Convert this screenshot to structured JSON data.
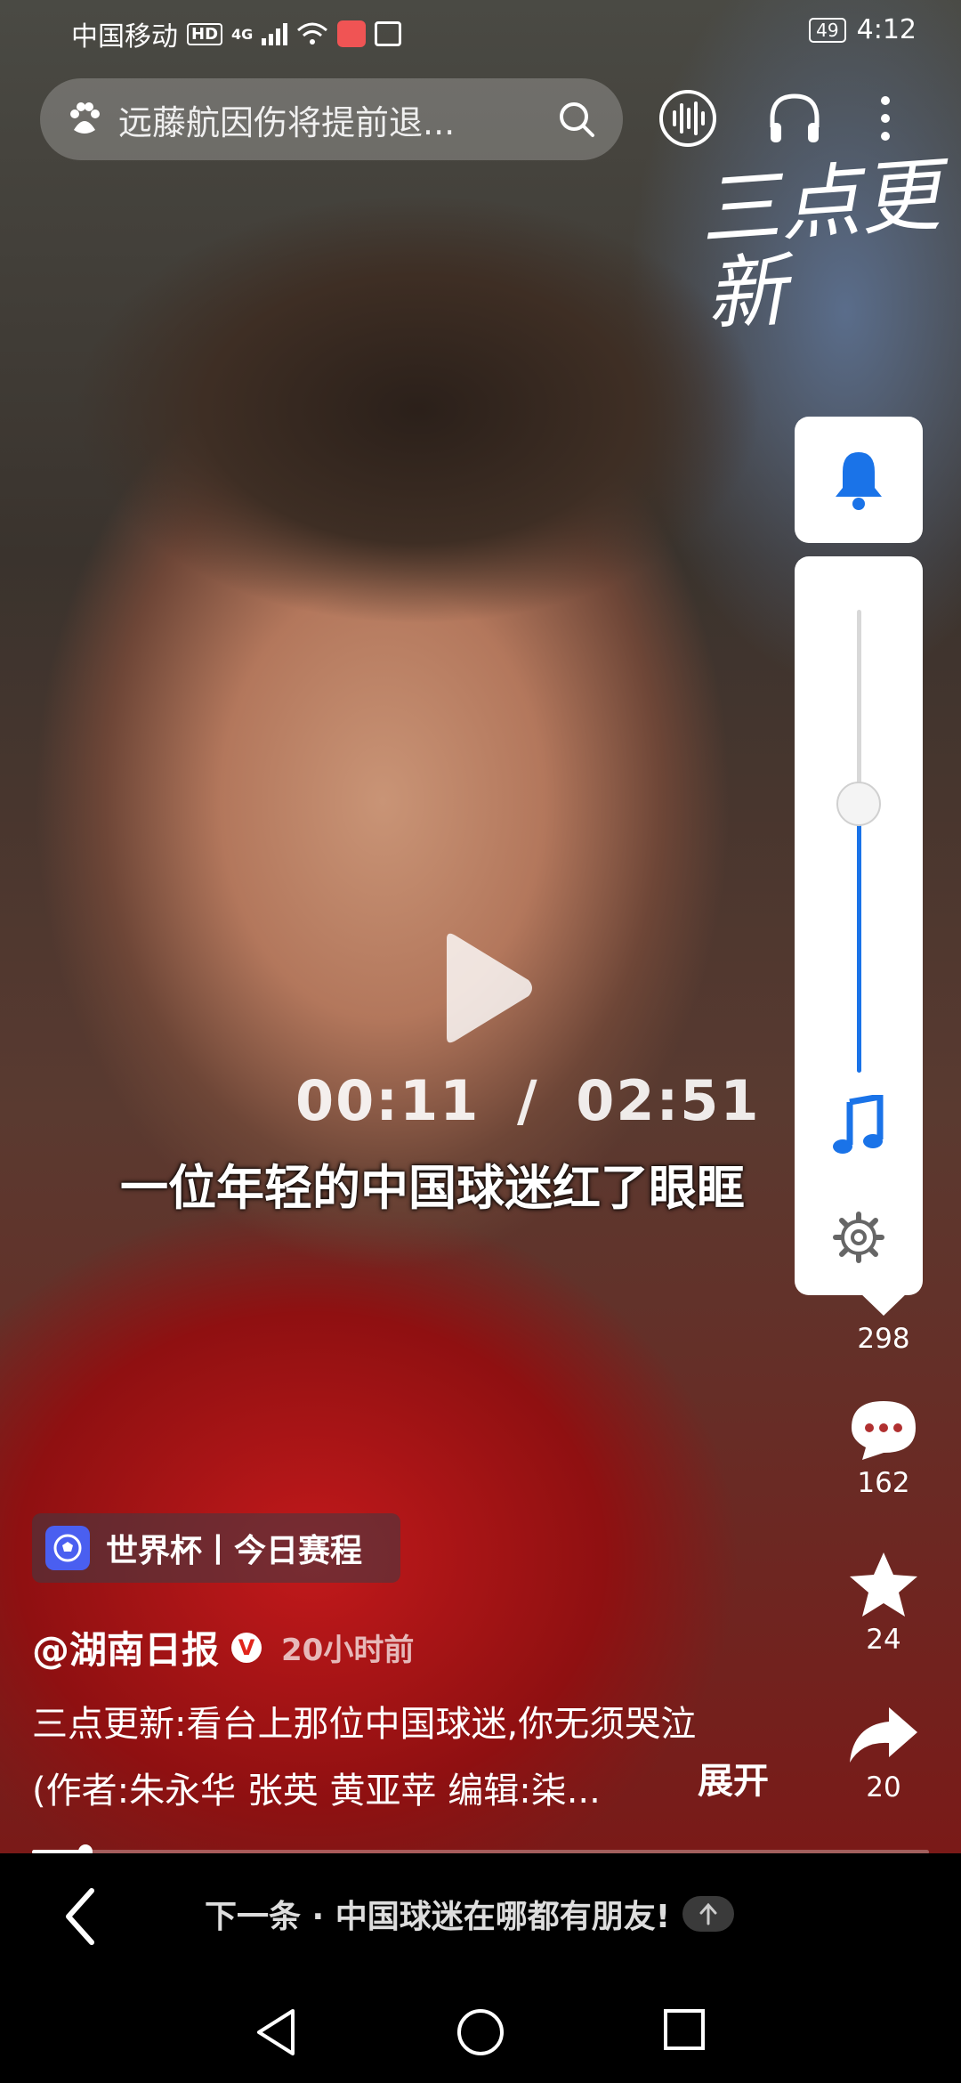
{
  "status_bar": {
    "carrier": "中国移动",
    "hd": "HD",
    "network": "4G",
    "battery": "49",
    "time": "4:12"
  },
  "search": {
    "placeholder": "远藤航因伤将提前退..."
  },
  "top_icons": [
    "audio-wave-icon",
    "headphones-icon",
    "more-icon"
  ],
  "watermark": "三点更新",
  "volume_panel": {
    "bell_icon": "bell-icon",
    "volume_level": 0.58,
    "music_icon": "music-note-icon",
    "settings_icon": "gear-icon"
  },
  "player": {
    "elapsed": "00:11",
    "separator": "/",
    "duration": "02:51",
    "subtitle": "一位年轻的中国球迷红了眼眶",
    "progress": 0.06
  },
  "side_stats": {
    "likes": "298",
    "comments": "162",
    "favorites": "24",
    "shares": "20"
  },
  "topic_tag": {
    "label": "世界杯丨今日赛程"
  },
  "post": {
    "author": "@湖南日报",
    "verified": "V",
    "time_ago": "20小时前",
    "desc_line1": "三点更新:看台上那位中国球迷,你无须哭泣",
    "desc_line2": "(作者:朱永华 张英 黄亚苹 编辑:柒...",
    "expand": "展开"
  },
  "bottom": {
    "next_label": "下一条 · 中国球迷在哪都有朋友!"
  },
  "colors": {
    "accent_blue": "#1a73e8",
    "verified_red": "#e1251b",
    "tag_ball": "#4a5ff0"
  }
}
